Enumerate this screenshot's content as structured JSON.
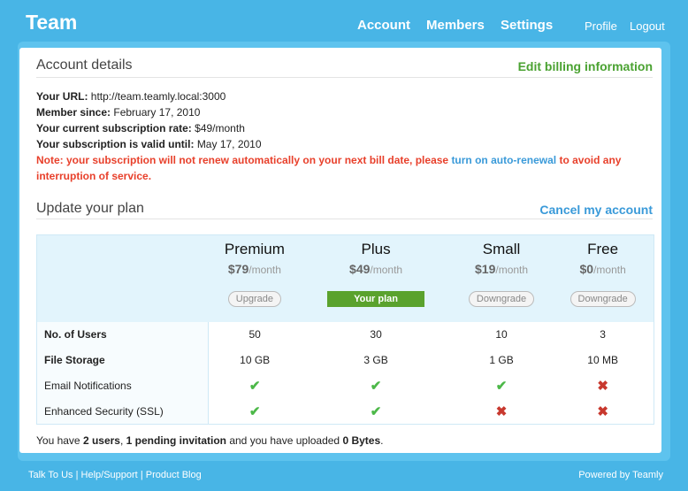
{
  "header": {
    "logo": "Team",
    "nav": [
      "Account",
      "Members",
      "Settings"
    ],
    "profile": "Profile",
    "logout": "Logout"
  },
  "account": {
    "title": "Account details",
    "edit_billing": "Edit billing information",
    "url_label": "Your URL:",
    "url": "http://team.teamly.local:3000",
    "since_label": "Member since:",
    "since": "February 17, 2010",
    "rate_label": "Your current subscription rate:",
    "rate": "$49/month",
    "valid_label": "Your subscription is valid until:",
    "valid": "May 17, 2010",
    "note_pre": "Note: your subscription will not renew automatically on your next bill date, please",
    "note_link": "turn on auto-renewal",
    "note_post": "to avoid any interruption of service."
  },
  "plan": {
    "title": "Update your plan",
    "cancel": "Cancel my account",
    "plans": [
      {
        "name": "Premium",
        "price": "$79",
        "per": "/month",
        "action": "Upgrade",
        "current": false
      },
      {
        "name": "Plus",
        "price": "$49",
        "per": "/month",
        "action": "Your plan",
        "current": true
      },
      {
        "name": "Small",
        "price": "$19",
        "per": "/month",
        "action": "Downgrade",
        "current": false
      },
      {
        "name": "Free",
        "price": "$0",
        "per": "/month",
        "action": "Downgrade",
        "current": false
      }
    ],
    "rows": [
      {
        "label": "No. of Users",
        "bold": true,
        "values": [
          "50",
          "30",
          "10",
          "3"
        ]
      },
      {
        "label": "File Storage",
        "bold": true,
        "values": [
          "10 GB",
          "3 GB",
          "1 GB",
          "10 MB"
        ]
      },
      {
        "label": "Email Notifications",
        "bold": false,
        "values": [
          true,
          true,
          true,
          false
        ]
      },
      {
        "label": "Enhanced Security (SSL)",
        "bold": false,
        "values": [
          true,
          true,
          false,
          false
        ]
      }
    ],
    "summary": {
      "a": "You have ",
      "users": "2 users",
      "b": ", ",
      "pending": "1 pending invitation",
      "c": " and you have uploaded ",
      "bytes": "0 Bytes",
      "d": "."
    }
  },
  "footer": {
    "links": [
      "Talk To Us",
      "Help/Support",
      "Product Blog"
    ],
    "sep": "|",
    "powered": "Powered by Teamly"
  },
  "colors": {
    "background": "#48b5e6",
    "green": "#5aa22d",
    "red": "#e8402b",
    "link": "#3a9ad9"
  }
}
